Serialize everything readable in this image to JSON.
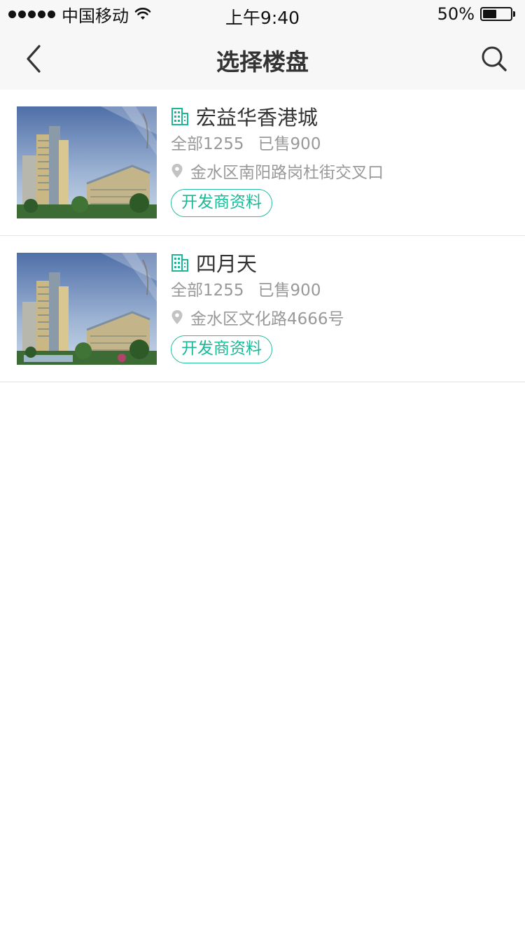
{
  "status_bar": {
    "carrier": "中国移动",
    "time": "上午9:40",
    "battery_text": "50%",
    "battery_level": 0.5
  },
  "nav": {
    "title": "选择楼盘",
    "back_icon": "chevron-left-icon",
    "search_icon": "search-icon"
  },
  "colors": {
    "accent": "#1bb898",
    "text_primary": "#333333",
    "text_secondary": "#999999",
    "bar_bg": "#f7f7f7"
  },
  "listings": [
    {
      "name": "宏益华香港城",
      "total": "全部1255",
      "sold": "已售900",
      "address": "金水区南阳路岗杜街交叉口",
      "button": "开发商资料"
    },
    {
      "name": "四月天",
      "total": "全部1255",
      "sold": "已售900",
      "address": "金水区文化路4666号",
      "button": "开发商资料"
    }
  ]
}
